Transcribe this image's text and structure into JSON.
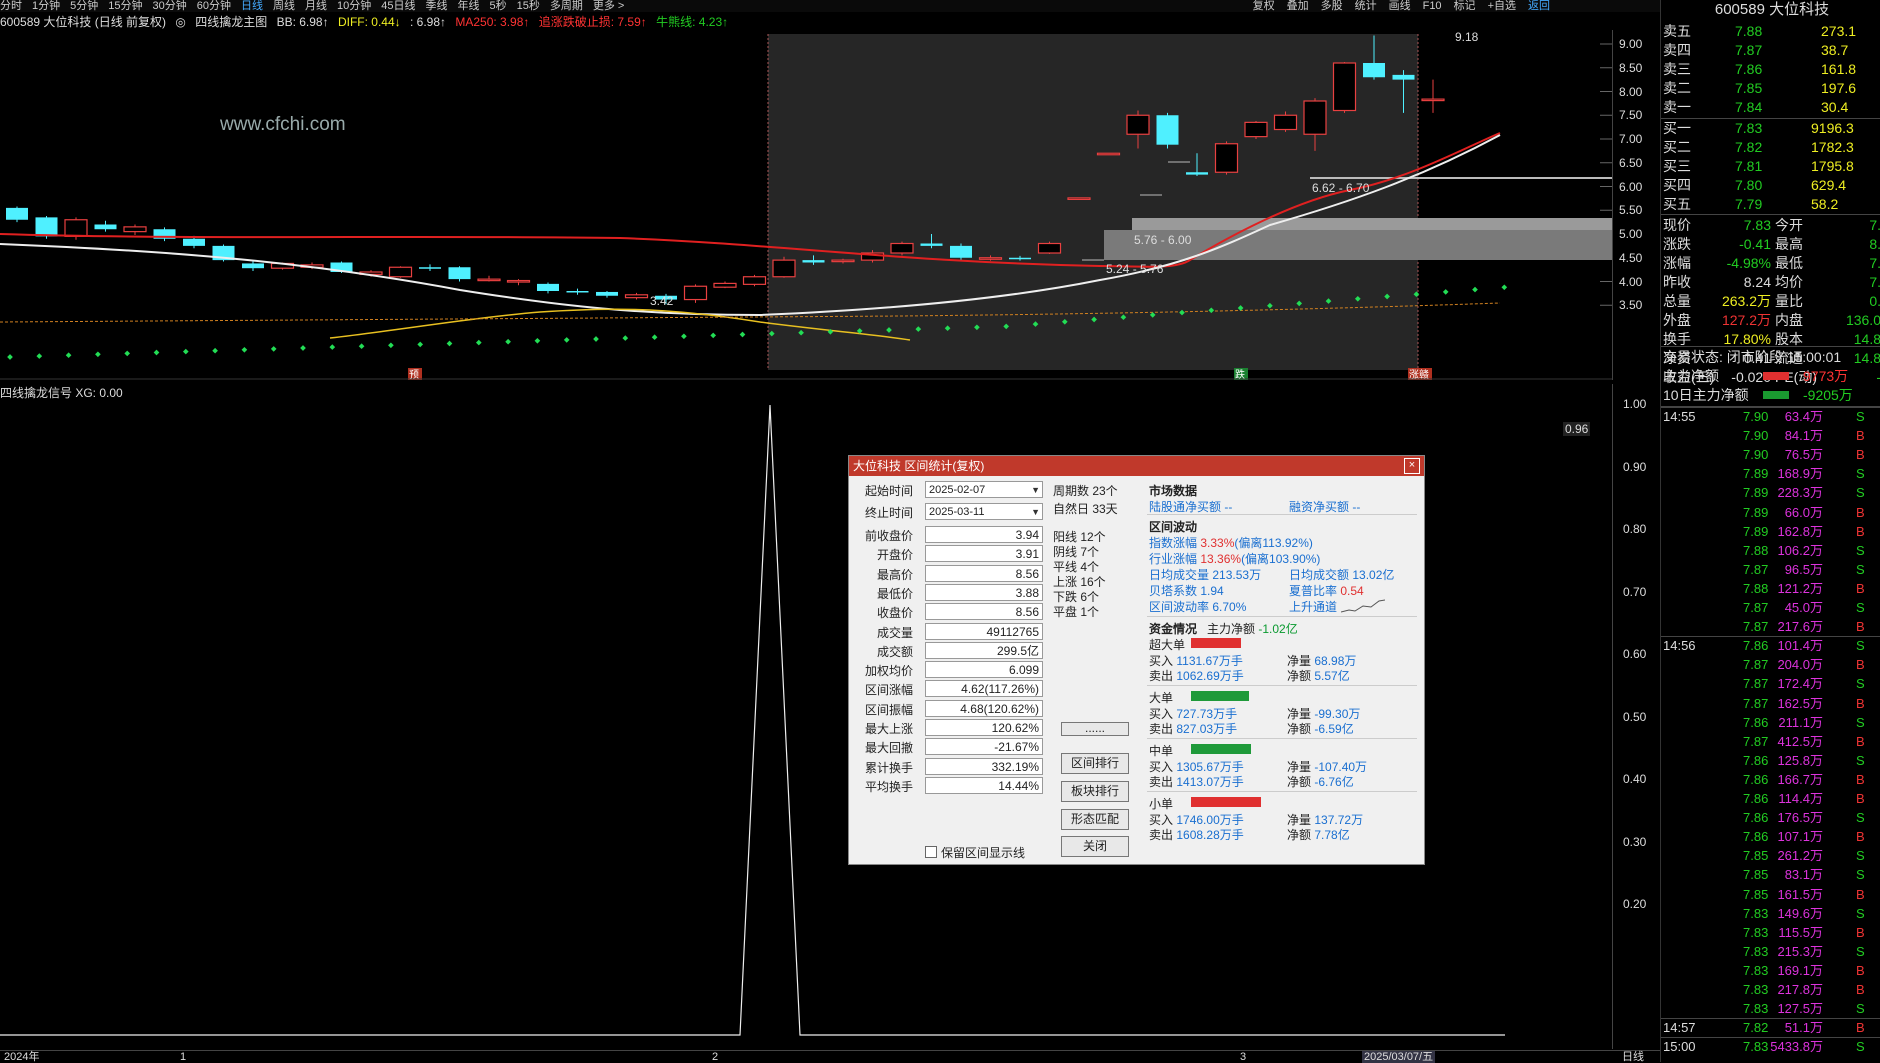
{
  "topbar": {
    "left_items": [
      "分时",
      "1分钟",
      "5分钟",
      "15分钟",
      "30分钟",
      "60分钟",
      "日线",
      "周线",
      "月线",
      "10分钟",
      "45日线",
      "季线",
      "年线",
      "5秒",
      "15秒",
      "多周期",
      "更多 >"
    ],
    "active": "日线",
    "right_items": [
      "复权",
      "叠加",
      "多股",
      "统计",
      "画线",
      "F10",
      "标记",
      "+自选",
      "返回"
    ],
    "right_active": "返回"
  },
  "infoline": {
    "stock": "600589 大位科技 (日线 前复权)",
    "indicator": "四线擒龙主图",
    "bb": "BB: 6.98↑",
    "diff": "DIFF: 0.44↓",
    "colon": ": 6.98↑",
    "ma250": "MA250: 3.98↑",
    "stoploss": "追涨跌破止损: 7.59↑",
    "bullline": "牛熊线: 4.23↑"
  },
  "watermark": "www.cfchi.com",
  "main_axis": [
    "9.00",
    "8.50",
    "8.00",
    "7.50",
    "7.00",
    "6.50",
    "6.00",
    "5.50",
    "5.00",
    "4.50",
    "4.00",
    "3.50"
  ],
  "sub_axis": [
    "1.00",
    "0.96",
    "0.90",
    "0.80",
    "0.70",
    "0.60",
    "0.50",
    "0.40",
    "0.30",
    "0.20"
  ],
  "chart_labels": {
    "high": "9.18",
    "low": "3.42",
    "range1": "6.62 - 6.70",
    "range2": "5.76 - 6.00",
    "range3": "5.24 - 5.76",
    "tag_yu": "预",
    "tag_die": "跌",
    "tag_zhangting": "涨赣"
  },
  "subchart_title": "四线擒龙信号 XG: 0.00",
  "xaxis": [
    "2024年",
    "1",
    "2",
    "3",
    "2025/03/07/五"
  ],
  "xaxis_right": "日线",
  "rpanel": {
    "header": "600589 大位科技",
    "asks": [
      {
        "label": "卖五",
        "price": "7.88",
        "vol": "273.1"
      },
      {
        "label": "卖四",
        "price": "7.87",
        "vol": "38.7"
      },
      {
        "label": "卖三",
        "price": "7.86",
        "vol": "161.8"
      },
      {
        "label": "卖二",
        "price": "7.85",
        "vol": "197.6"
      },
      {
        "label": "卖一",
        "price": "7.84",
        "vol": "30.4"
      }
    ],
    "bids": [
      {
        "label": "买一",
        "price": "7.83",
        "vol": "9196.3"
      },
      {
        "label": "买二",
        "price": "7.82",
        "vol": "1782.3"
      },
      {
        "label": "买三",
        "price": "7.81",
        "vol": "1795.8"
      },
      {
        "label": "买四",
        "price": "7.80",
        "vol": "629.4"
      },
      {
        "label": "买五",
        "price": "7.79",
        "vol": "58.2"
      }
    ],
    "stats": [
      {
        "l1": "现价",
        "v1": "7.83",
        "l2": "今开",
        "v2": "7."
      },
      {
        "l1": "涨跌",
        "v1": "-0.41",
        "l2": "最高",
        "v2": "8."
      },
      {
        "l1": "涨幅",
        "v1": "-4.98%",
        "l2": "最低",
        "v2": "7."
      },
      {
        "l1": "昨收",
        "v1": "8.24",
        "l2": "均价",
        "v2": "7."
      },
      {
        "l1": "总量",
        "v1": "263.2万",
        "l2": "量比",
        "v2": "0."
      },
      {
        "l1": "外盘",
        "v1": "127.2万",
        "l2": "内盘",
        "v2": "136.0"
      },
      {
        "l1": "换手",
        "v1": "17.80%",
        "l2": "股本",
        "v2": "14.8"
      },
      {
        "l1": "净资",
        "v1": "0.41",
        "l2": "流通",
        "v2": "14.8"
      },
      {
        "l1": "收益(三)",
        "v1": "-0.020",
        "l2": "PE(动)",
        "v2": "-"
      }
    ],
    "status": "交易状态: 闭市阶段 15:00:01",
    "flow1_label": "主力净额",
    "flow1_val": "9773万",
    "flow2_label": "10日主力净额",
    "flow2_val": "-9205万",
    "ticks": [
      {
        "t": "14:55",
        "p": "7.90",
        "v": "63.4万",
        "s": "S"
      },
      {
        "t": "",
        "p": "7.90",
        "v": "84.1万",
        "s": "B"
      },
      {
        "t": "",
        "p": "7.90",
        "v": "76.5万",
        "s": "B"
      },
      {
        "t": "",
        "p": "7.89",
        "v": "168.9万",
        "s": "S"
      },
      {
        "t": "",
        "p": "7.89",
        "v": "228.3万",
        "s": "S"
      },
      {
        "t": "",
        "p": "7.89",
        "v": "66.0万",
        "s": "B"
      },
      {
        "t": "",
        "p": "7.89",
        "v": "162.8万",
        "s": "B"
      },
      {
        "t": "",
        "p": "7.88",
        "v": "106.2万",
        "s": "S"
      },
      {
        "t": "",
        "p": "7.87",
        "v": "96.5万",
        "s": "S"
      },
      {
        "t": "",
        "p": "7.88",
        "v": "121.2万",
        "s": "B"
      },
      {
        "t": "",
        "p": "7.87",
        "v": "45.0万",
        "s": "S"
      },
      {
        "t": "",
        "p": "7.87",
        "v": "217.6万",
        "s": "B"
      },
      {
        "t": "14:56",
        "p": "7.86",
        "v": "101.4万",
        "s": "S"
      },
      {
        "t": "",
        "p": "7.87",
        "v": "204.0万",
        "s": "B"
      },
      {
        "t": "",
        "p": "7.87",
        "v": "172.4万",
        "s": "S"
      },
      {
        "t": "",
        "p": "7.87",
        "v": "162.5万",
        "s": "B"
      },
      {
        "t": "",
        "p": "7.86",
        "v": "211.1万",
        "s": "S"
      },
      {
        "t": "",
        "p": "7.87",
        "v": "412.5万",
        "s": "B"
      },
      {
        "t": "",
        "p": "7.86",
        "v": "125.8万",
        "s": "S"
      },
      {
        "t": "",
        "p": "7.86",
        "v": "166.7万",
        "s": "B"
      },
      {
        "t": "",
        "p": "7.86",
        "v": "114.4万",
        "s": "B"
      },
      {
        "t": "",
        "p": "7.86",
        "v": "176.5万",
        "s": "S"
      },
      {
        "t": "",
        "p": "7.86",
        "v": "107.1万",
        "s": "B"
      },
      {
        "t": "",
        "p": "7.85",
        "v": "261.2万",
        "s": "S"
      },
      {
        "t": "",
        "p": "7.85",
        "v": "83.1万",
        "s": "S"
      },
      {
        "t": "",
        "p": "7.85",
        "v": "161.5万",
        "s": "B"
      },
      {
        "t": "",
        "p": "7.83",
        "v": "149.6万",
        "s": "S"
      },
      {
        "t": "",
        "p": "7.83",
        "v": "115.5万",
        "s": "B"
      },
      {
        "t": "",
        "p": "7.83",
        "v": "215.3万",
        "s": "S"
      },
      {
        "t": "",
        "p": "7.83",
        "v": "169.1万",
        "s": "B"
      },
      {
        "t": "",
        "p": "7.83",
        "v": "217.8万",
        "s": "B"
      },
      {
        "t": "",
        "p": "7.83",
        "v": "127.5万",
        "s": "S"
      },
      {
        "t": "14:57",
        "p": "7.82",
        "v": "51.1万",
        "s": "B"
      },
      {
        "t": "15:00",
        "p": "7.83",
        "v": "5433.8万",
        "s": "S"
      }
    ]
  },
  "dialog": {
    "title": "大位科技 区间统计(复权)",
    "close": "×",
    "start_label": "起始时间",
    "start_val": "2025-02-07",
    "end_label": "终止时间",
    "end_val": "2025-03-11",
    "fields": [
      {
        "label": "前收盘价",
        "value": "3.94"
      },
      {
        "label": "开盘价",
        "value": "3.91"
      },
      {
        "label": "最高价",
        "value": "8.56"
      },
      {
        "label": "最低价",
        "value": "3.88"
      },
      {
        "label": "收盘价",
        "value": "8.56"
      },
      {
        "label": "成交量",
        "value": "49112765"
      },
      {
        "label": "成交额",
        "value": "299.5亿"
      },
      {
        "label": "加权均价",
        "value": "6.099"
      },
      {
        "label": "区间涨幅",
        "value": "4.62(117.26%)"
      },
      {
        "label": "区间振幅",
        "value": "4.68(120.62%)"
      },
      {
        "label": "最大上涨",
        "value": "120.62%"
      },
      {
        "label": "最大回撤",
        "value": "-21.67%"
      },
      {
        "label": "累计换手",
        "value": "332.19%"
      },
      {
        "label": "平均换手",
        "value": "14.44%"
      }
    ],
    "keep_label": "保留区间显示线",
    "period_count": "周期数 23个",
    "natural_days": "自然日 33天",
    "counts": [
      "阳线 12个",
      "阴线 7个",
      "平线 4个",
      "上涨 16个",
      "下跌 6个",
      "平盘 1个"
    ],
    "buttons": [
      "......",
      "区间排行",
      "板块排行",
      "形态匹配",
      "关闭"
    ],
    "market_title": "市场数据",
    "hk_flow": "陆股通净买额 --",
    "margin_flow": "融资净买额 --",
    "vol_title": "区间波动",
    "index_change_l": "指数涨幅",
    "index_change_v": "3.33%",
    "index_dev": "(偏离113.92%)",
    "ind_change_l": "行业涨幅",
    "ind_change_v": "13.36%",
    "ind_dev": "(偏离103.90%)",
    "avg_vol_l": "日均成交量",
    "avg_vol_v": "213.53万",
    "avg_amt_l": "日均成交额",
    "avg_amt_v": "13.02亿",
    "beta_l": "贝塔系数",
    "beta_v": "1.94",
    "sharpe_l": "夏普比率",
    "sharpe_v": "0.54",
    "volat_l": "区间波动率",
    "volat_v": "6.70%",
    "channel": "上升通道",
    "fund_title": "资金情况",
    "main_net_l": "主力净额",
    "main_net_v": "-1.02亿",
    "groups": [
      {
        "name": "超大单",
        "color": "#e03030",
        "buy": "1131.67万手",
        "sell": "1062.69万手",
        "net_vol": "68.98万",
        "net_amt": "5.57亿"
      },
      {
        "name": "大单",
        "color": "#1f9a3a",
        "buy": "727.73万手",
        "sell": "827.03万手",
        "net_vol": "-99.30万",
        "net_amt": "-6.59亿"
      },
      {
        "name": "中单",
        "color": "#1f9a3a",
        "buy": "1305.67万手",
        "sell": "1413.07万手",
        "net_vol": "-107.40万",
        "net_amt": "-6.76亿"
      },
      {
        "name": "小单",
        "color": "#e03030",
        "buy": "1746.00万手",
        "sell": "1608.28万手",
        "net_vol": "137.72万",
        "net_amt": "7.78亿"
      }
    ],
    "buy_l": "买入",
    "sell_l": "卖出",
    "netvol_l": "净量",
    "netamt_l": "净额"
  }
}
